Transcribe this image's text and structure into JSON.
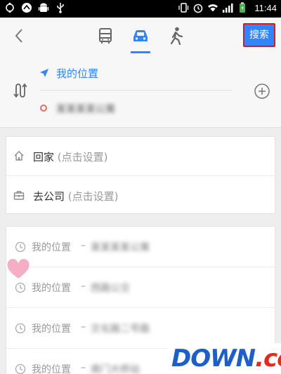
{
  "status_bar": {
    "time": "11:44"
  },
  "top_bar": {
    "modes": [
      "bus-icon",
      "car-icon",
      "walk-icon"
    ],
    "active_mode": "car",
    "search_label": "搜索"
  },
  "route": {
    "from": "我的位置",
    "to": "某某某某公寓"
  },
  "quick": {
    "home": {
      "label": "回家",
      "hint": "(点击设置)"
    },
    "company": {
      "label": "去公司",
      "hint": "(点击设置)"
    }
  },
  "history": [
    {
      "from": "我的位置",
      "sep": "–",
      "to": "某某某某公寓"
    },
    {
      "from": "我的位置",
      "sep": "–",
      "to": "西路公交"
    },
    {
      "from": "我的位置",
      "sep": "–",
      "to": "文化路二号路"
    },
    {
      "from": "我的位置",
      "sep": "–",
      "to": "南门大桥站"
    }
  ],
  "watermark": {
    "logo_main": "DOWN",
    "logo_sub": ".cc"
  },
  "colors": {
    "accent": "#3385ff",
    "dest_dot": "#e46d5f",
    "logo_blue": "#1e5fc7",
    "logo_red": "#e02b20"
  }
}
